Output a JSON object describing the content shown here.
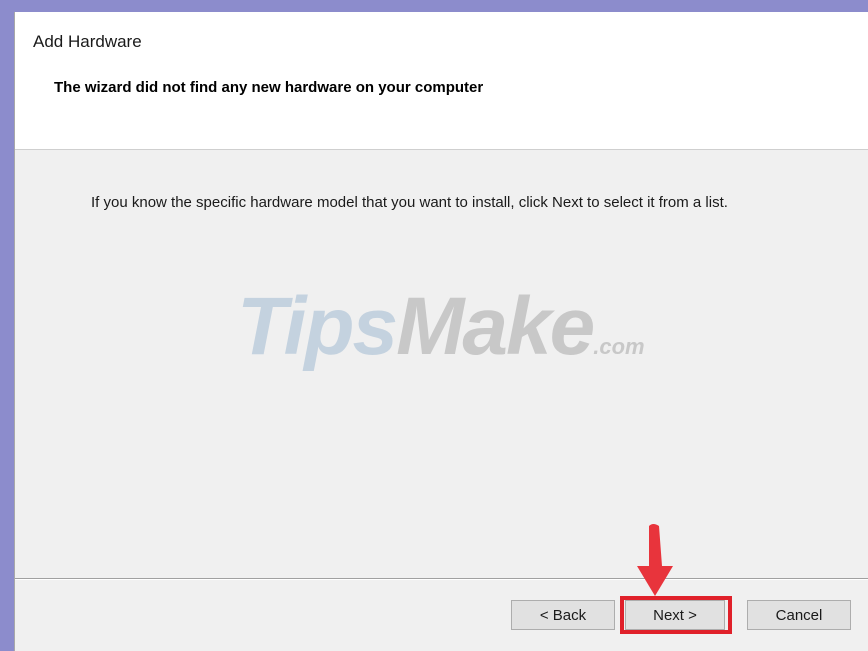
{
  "window": {
    "title": "Add Hardware",
    "subtitle": "The wizard did not find any new hardware on your computer"
  },
  "body": {
    "message": "If you know the specific hardware model that you want to install, click Next to select it from a list."
  },
  "watermark": {
    "part1": "Tips",
    "part2": "Make",
    "suffix": ".com"
  },
  "buttons": {
    "back": "< Back",
    "next": "Next >",
    "cancel": "Cancel"
  },
  "colors": {
    "highlight": "#e0202a",
    "arrow": "#e8343c"
  },
  "icons": {
    "pointer": "down-arrow-icon"
  }
}
